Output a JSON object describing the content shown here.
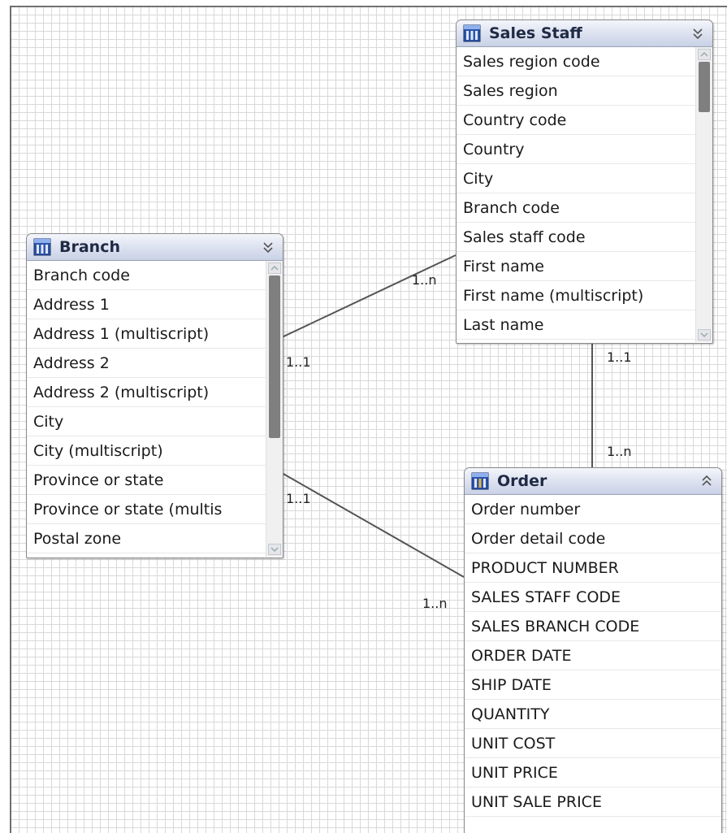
{
  "diagram": {
    "entities": {
      "branch": {
        "title": "Branch",
        "fields": [
          "Branch code",
          "Address 1",
          "Address 1 (multiscript)",
          "Address 2",
          "Address 2 (multiscript)",
          "City",
          "City (multiscript)",
          "Province or state",
          "Province  or  state (multis",
          "Postal zone"
        ]
      },
      "sales_staff": {
        "title": "Sales Staff",
        "fields": [
          "Sales region code",
          "Sales region",
          "Country code",
          "Country",
          "City",
          "Branch code",
          "Sales staff code",
          "First name",
          "First name (multiscript)",
          "Last name"
        ]
      },
      "order": {
        "title": "Order",
        "fields": [
          "Order number",
          "Order detail code",
          "PRODUCT  NUMBER",
          "SALES  STAFF  CODE",
          "SALES  BRANCH  CODE",
          "ORDER  DATE",
          "SHIP  DATE",
          "QUANTITY",
          "UNIT  COST",
          "UNIT  PRICE",
          "UNIT  SALE  PRICE"
        ]
      }
    },
    "relationships": [
      {
        "from": "Branch",
        "to": "Sales Staff",
        "from_cardinality": "1..1",
        "to_cardinality": "1..n"
      },
      {
        "from": "Branch",
        "to": "Order",
        "from_cardinality": "1..1",
        "to_cardinality": "1..n"
      },
      {
        "from": "Sales Staff",
        "to": "Order",
        "from_cardinality": "1..1",
        "to_cardinality": "1..n"
      }
    ],
    "icon_names": {
      "table": "table-icon",
      "collapse": "chevron-double-down-icon",
      "expand": "chevron-double-up-icon"
    },
    "colors": {
      "header_top": "#f4f6fb",
      "header_bottom": "#c9d1e6",
      "grid": "#d9d9d9",
      "link": "#555555"
    }
  }
}
